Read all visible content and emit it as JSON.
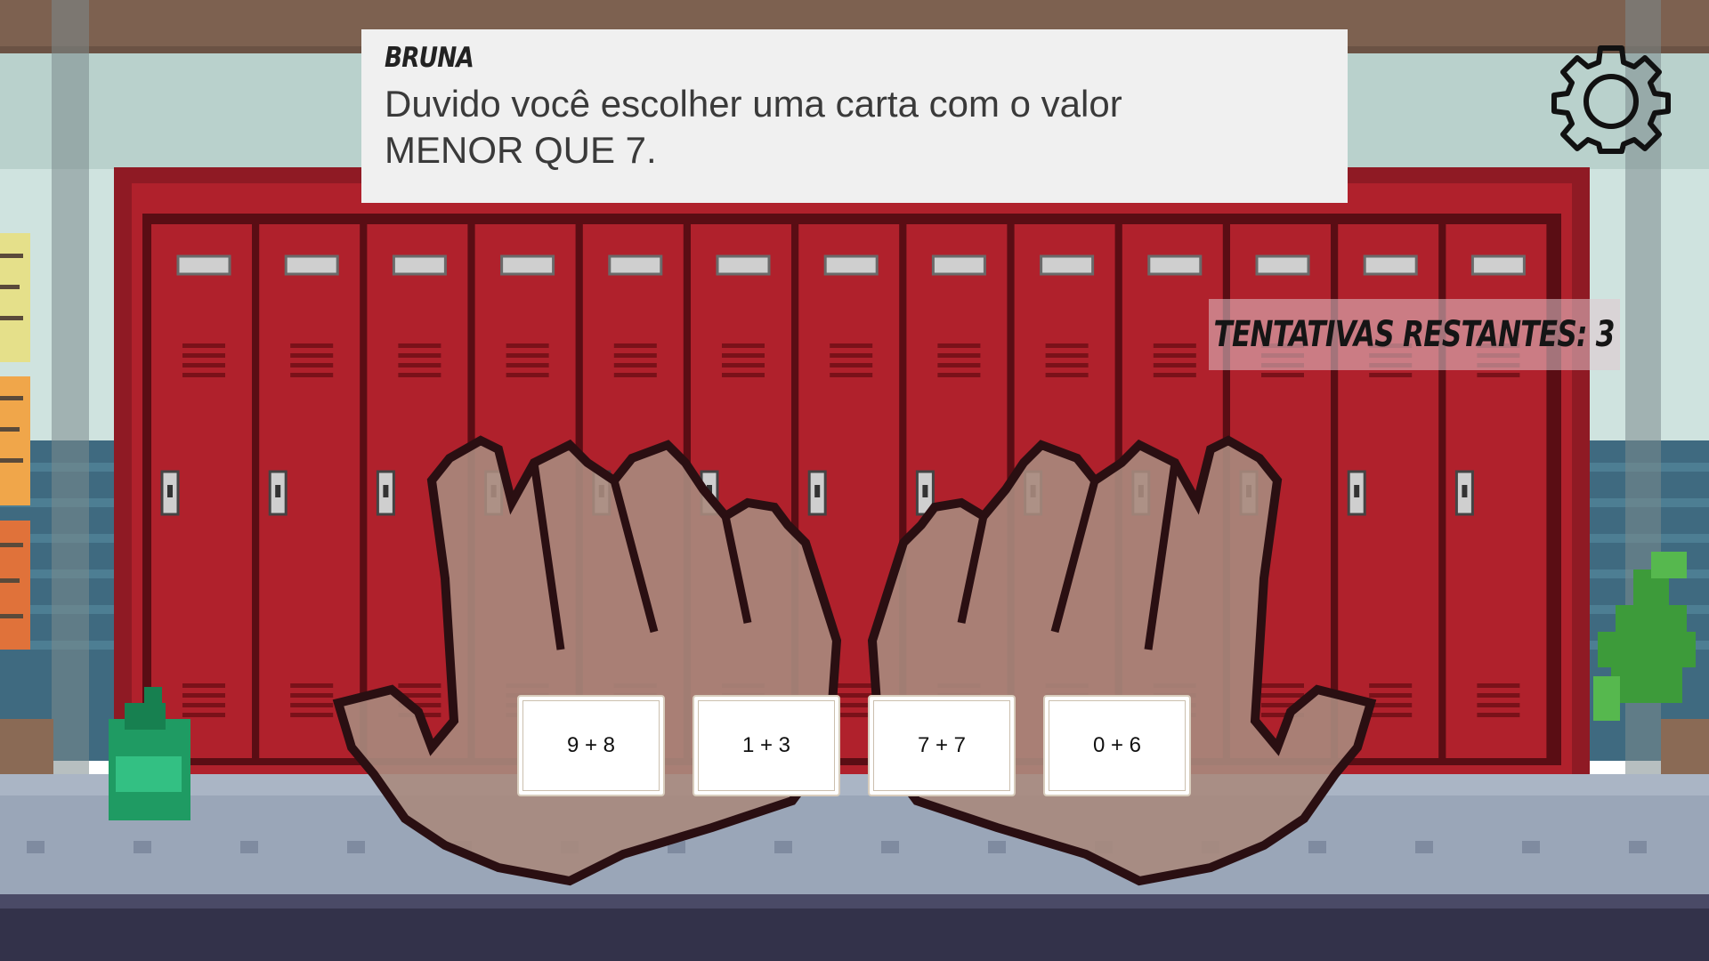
{
  "dialog": {
    "speaker": "BRUNA",
    "line1": "Duvido você escolher uma carta com o valor",
    "line2": "MENOR QUE 7."
  },
  "attempts": {
    "text": "TENTATIVAS RESTANTES: 3"
  },
  "cards": [
    {
      "label": "9 + 8"
    },
    {
      "label": "1 + 3"
    },
    {
      "label": "7 + 7"
    },
    {
      "label": "0 + 6"
    }
  ],
  "icons": {
    "settings": "gear-icon"
  },
  "colors": {
    "locker": "#b0212c",
    "locker_frame": "#8f1a24",
    "wall": "#cfe3df",
    "floor": "#9aa6b8",
    "dialog_bg": "#f0f0f0"
  }
}
